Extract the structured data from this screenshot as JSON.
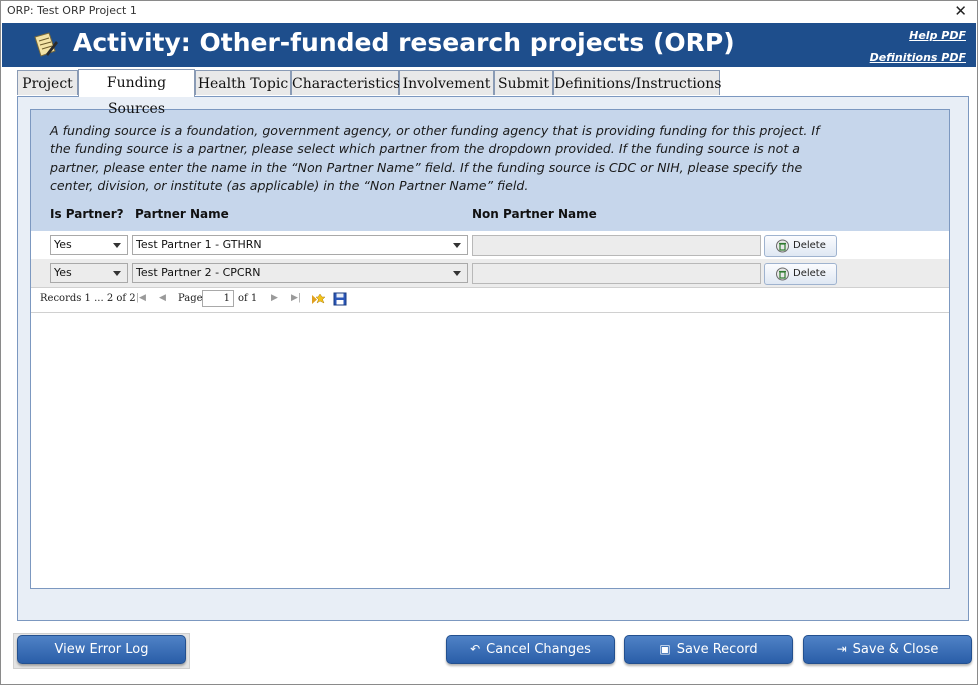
{
  "window": {
    "title": "ORP: Test ORP Project 1",
    "close_glyph": "✕"
  },
  "header": {
    "title": "Activity: Other-funded research projects (ORP)",
    "help_link": "Help PDF",
    "definitions_link": "Definitions PDF",
    "icon": "notepad-icon",
    "bg_color": "#1e4e8c"
  },
  "tabs": [
    {
      "label": "Project"
    },
    {
      "label": "Funding Sources",
      "active": true
    },
    {
      "label": "Health Topic"
    },
    {
      "label": "Characteristics"
    },
    {
      "label": "Involvement"
    },
    {
      "label": "Submit"
    },
    {
      "label": "Definitions/Instructions"
    }
  ],
  "funding": {
    "description": "A funding source is a foundation, government agency, or other funding agency that is providing funding for this project. If the funding source is a partner, please select which partner from the dropdown provided. If the funding source is not a partner, please enter the name in the “Non Partner Name” field. If the funding source is CDC or NIH, please specify the center, division, or institute (as applicable) in the “Non Partner Name” field.",
    "columns": {
      "is_partner": "Is Partner?",
      "partner_name": "Partner Name",
      "non_partner_name": "Non Partner Name"
    },
    "rows": [
      {
        "is_partner": "Yes",
        "partner_name": "Test Partner 1 - GTHRN",
        "non_partner_name": "",
        "delete_label": "Delete"
      },
      {
        "is_partner": "Yes",
        "partner_name": "Test Partner 2 - CPCRN",
        "non_partner_name": "",
        "delete_label": "Delete"
      }
    ],
    "pager": {
      "records": "Records 1 ... 2 of 2",
      "page_label": "Page",
      "page_value": "1",
      "of_label": "of 1"
    }
  },
  "footer": {
    "view_error_log": "View Error Log",
    "cancel_changes": "Cancel Changes",
    "save_record": "Save Record",
    "save_close": "Save & Close"
  }
}
